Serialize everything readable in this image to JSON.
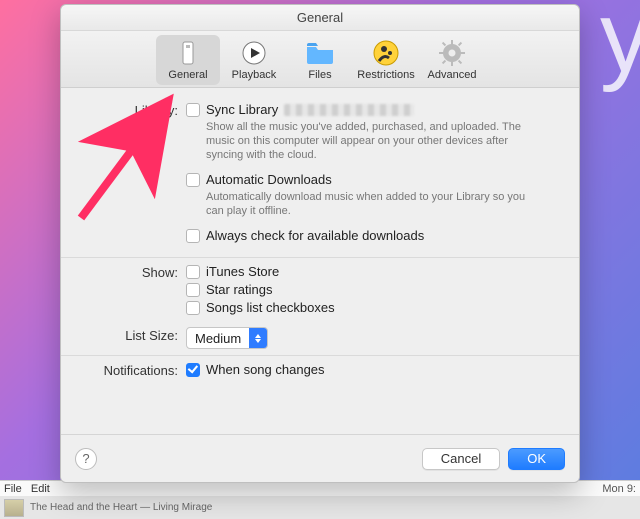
{
  "window": {
    "title": "General"
  },
  "toolbar": {
    "items": [
      {
        "label": "General",
        "icon": "slider-icon",
        "selected": true
      },
      {
        "label": "Playback",
        "icon": "play-icon",
        "selected": false
      },
      {
        "label": "Files",
        "icon": "folder-icon",
        "selected": false
      },
      {
        "label": "Restrictions",
        "icon": "parental-icon",
        "selected": false
      },
      {
        "label": "Advanced",
        "icon": "gear-icon",
        "selected": false
      }
    ]
  },
  "sections": {
    "library": {
      "label": "Library:",
      "sync": {
        "label": "Sync Library",
        "checked": false,
        "desc": "Show all the music you've added, purchased, and uploaded. The music on this computer will appear on your other devices after syncing with the cloud."
      },
      "auto": {
        "label": "Automatic Downloads",
        "checked": false,
        "desc": "Automatically download music when added to your Library so you can play it offline."
      },
      "check": {
        "label": "Always check for available downloads",
        "checked": false
      }
    },
    "show": {
      "label": "Show:",
      "store": {
        "label": "iTunes Store",
        "checked": false
      },
      "stars": {
        "label": "Star ratings",
        "checked": false
      },
      "boxes": {
        "label": "Songs list checkboxes",
        "checked": false
      }
    },
    "listsize": {
      "label": "List Size:",
      "value": "Medium"
    },
    "notifications": {
      "label": "Notifications:",
      "song": {
        "label": "When song changes",
        "checked": true
      }
    }
  },
  "footer": {
    "help": "?",
    "cancel": "Cancel",
    "ok": "OK"
  },
  "background": {
    "menubar": {
      "left_items": [
        "File",
        "Edit"
      ],
      "right": "Mon 9:"
    },
    "dock_track": "The Head and the Heart — Living Mirage"
  }
}
